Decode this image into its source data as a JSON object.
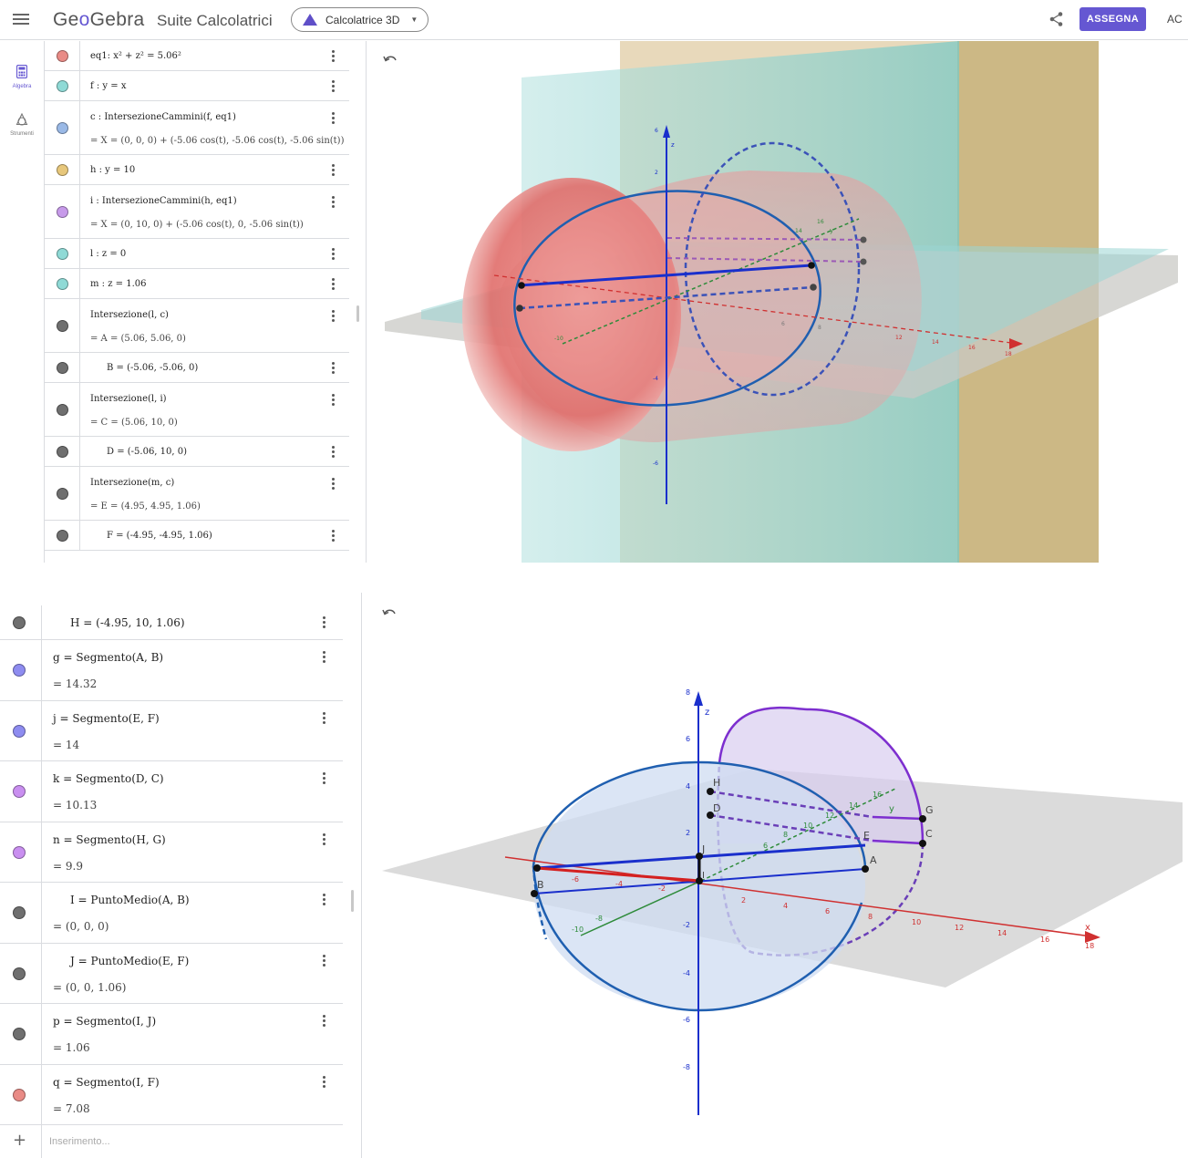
{
  "header": {
    "logo_pre": "Ge",
    "logo_o": "o",
    "logo_post": "Gebra",
    "suite_title": "Suite Calcolatrici",
    "app_switch_label": "Calcolatrice 3D",
    "assign_label": "ASSEGNA",
    "login_partial": "AC",
    "colors": {
      "accent": "#6557d2"
    }
  },
  "sidebar": {
    "algebra_label": "Algebra",
    "tools_label": "Strumenti"
  },
  "algebra_top": [
    {
      "color": "#e98b86",
      "line1": "eq1: x² + z² = 5.06²",
      "line2": ""
    },
    {
      "color": "#8fdad6",
      "line1": "f : y = x",
      "line2": ""
    },
    {
      "color": "#9ab9e6",
      "line1": "c : IntersezioneCammini(f, eq1)",
      "line2": "= X = (0, 0, 0) + (-5.06 cos(t), -5.06 cos(t), -5.06 sin(t))"
    },
    {
      "color": "#e7c77b",
      "line1": "h : y = 10",
      "line2": ""
    },
    {
      "color": "#c79aea",
      "line1": "i : IntersezioneCammini(h, eq1)",
      "line2": "= X = (0, 10, 0) + (-5.06 cos(t), 0, -5.06 sin(t))"
    },
    {
      "color": "#8fdad6",
      "line1": "l : z = 0",
      "line2": ""
    },
    {
      "color": "#8fdad6",
      "line1": "m : z = 1.06",
      "line2": ""
    },
    {
      "color": "#6f6f6f",
      "line1": "Intersezione(l, c)",
      "line2": "= A = (5.06, 5.06, 0)"
    },
    {
      "color": "#6f6f6f",
      "line1": "B = (-5.06, -5.06, 0)",
      "line2": ""
    },
    {
      "color": "#6f6f6f",
      "line1": "Intersezione(l, i)",
      "line2": "= C = (5.06, 10, 0)"
    },
    {
      "color": "#6f6f6f",
      "line1": "D = (-5.06, 10, 0)",
      "line2": ""
    },
    {
      "color": "#6f6f6f",
      "line1": "Intersezione(m, c)",
      "line2": "= E = (4.95, 4.95, 1.06)"
    },
    {
      "color": "#6f6f6f",
      "line1": "F = (-4.95, -4.95, 1.06)",
      "line2": ""
    }
  ],
  "algebra_bottom": [
    {
      "color": "#6f6f6f",
      "line1": "H = (-4.95, 10, 1.06)",
      "line2": ""
    },
    {
      "color": "#8e8cf0",
      "line1": "g = Segmento(A, B)",
      "line2": "= 14.32"
    },
    {
      "color": "#8e8cf0",
      "line1": "j = Segmento(E, F)",
      "line2": "= 14"
    },
    {
      "color": "#c98ff0",
      "line1": "k = Segmento(D, C)",
      "line2": "= 10.13"
    },
    {
      "color": "#c98ff0",
      "line1": "n = Segmento(H, G)",
      "line2": "= 9.9"
    },
    {
      "color": "#6f6f6f",
      "line1": "I = PuntoMedio(A, B)",
      "line2": "= (0, 0, 0)"
    },
    {
      "color": "#6f6f6f",
      "line1": "J = PuntoMedio(E, F)",
      "line2": "= (0, 0, 1.06)"
    },
    {
      "color": "#6f6f6f",
      "line1": "p = Segmento(I, J)",
      "line2": "= 1.06"
    },
    {
      "color": "#e98b86",
      "line1": "q = Segmento(I, F)",
      "line2": "= 7.08"
    }
  ],
  "input": {
    "placeholder": "Inserimento..."
  },
  "view_top": {
    "z_ticks": [
      "2",
      "6"
    ],
    "neg_z_ticks": [
      "-6",
      "-4"
    ],
    "x_ticks": [
      "6",
      "8",
      "12",
      "14",
      "16"
    ],
    "x_end": "18",
    "y_ticks": [
      "14",
      "16"
    ],
    "neg_y_tick": "-10",
    "axis_z": "z",
    "axis_y": "y"
  },
  "view_bottom": {
    "z_ticks": [
      "8",
      "6",
      "4",
      "2"
    ],
    "neg_z_ticks": [
      "-2",
      "-4",
      "-6",
      "-8"
    ],
    "x_ticks": [
      "2",
      "4",
      "6",
      "8",
      "10",
      "12",
      "14",
      "16"
    ],
    "x_end": "18",
    "neg_x_ticks": [
      "-6",
      "-4",
      "-2"
    ],
    "y_ticks": [
      "6",
      "8",
      "10",
      "12",
      "14",
      "16"
    ],
    "neg_y_ticks": [
      "-10",
      "-8"
    ],
    "axis_x": "x",
    "axis_y": "y",
    "axis_z": "z",
    "points": [
      "A",
      "B",
      "C",
      "D",
      "E",
      "G",
      "H",
      "J",
      "I"
    ]
  }
}
